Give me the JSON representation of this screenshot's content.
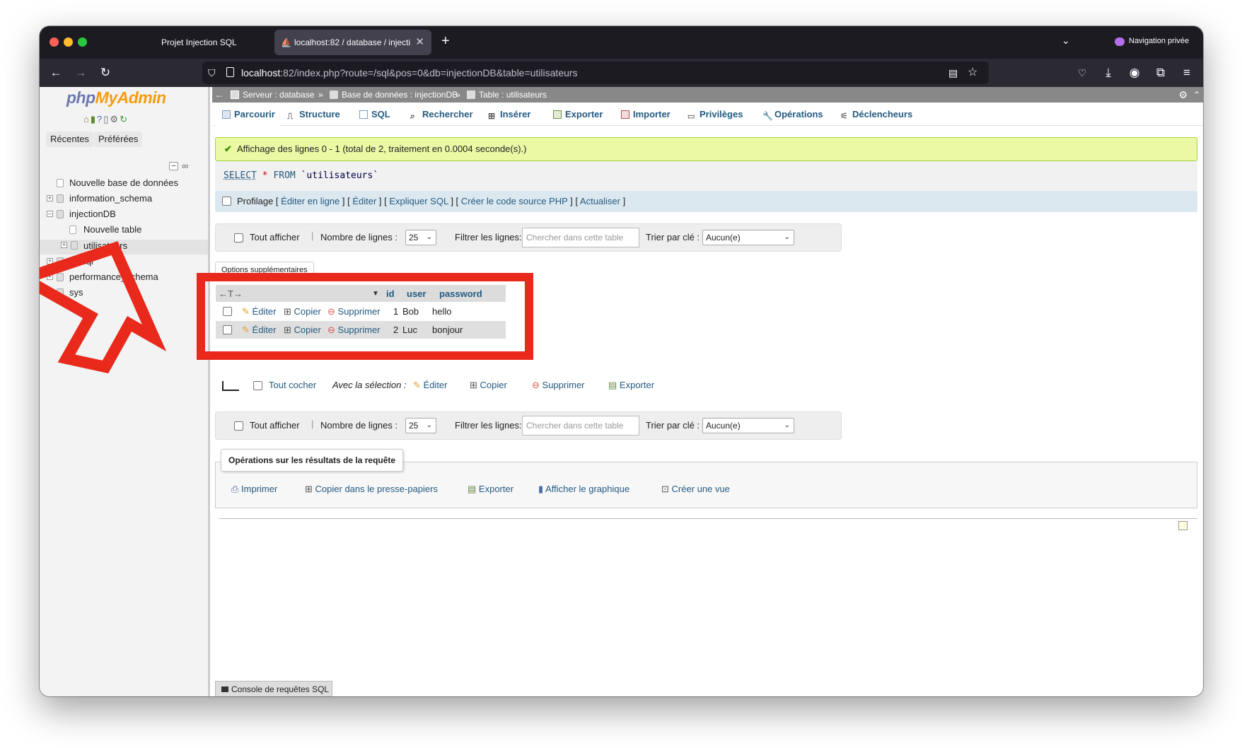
{
  "browser": {
    "tabs": [
      {
        "title": "Projet Injection SQL"
      },
      {
        "title": "localhost:82 / database / injecti"
      }
    ],
    "private_label": "Navigation privée",
    "url_host": "localhost",
    "url_rest": ":82/index.php?route=/sql&pos=0&db=injectionDB&table=utilisateurs"
  },
  "sidebar": {
    "logo_php": "php",
    "logo_my": "MyAdmin",
    "recent_label": "Récentes",
    "favorites_label": "Préférées",
    "tree": [
      {
        "label": "Nouvelle base de données",
        "indent": 0
      },
      {
        "label": "information_schema",
        "indent": 0
      },
      {
        "label": "injectionDB",
        "indent": 0
      },
      {
        "label": "Nouvelle table",
        "indent": 1
      },
      {
        "label": "utilisateurs",
        "indent": 1
      },
      {
        "label": "mysql",
        "indent": 0
      },
      {
        "label": "performance_schema",
        "indent": 0
      },
      {
        "label": "sys",
        "indent": 0
      }
    ]
  },
  "breadcrumb": {
    "server": "Serveur : database",
    "database": "Base de données : injectionDB",
    "table": "Table : utilisateurs"
  },
  "tabs": [
    "Parcourir",
    "Structure",
    "SQL",
    "Rechercher",
    "Insérer",
    "Exporter",
    "Importer",
    "Privilèges",
    "Opérations",
    "Déclencheurs"
  ],
  "result": {
    "success_message": "Affichage des lignes 0 - 1 (total de 2, traitement en 0.0004 seconde(s).)",
    "sql_select": "SELECT",
    "sql_star": "*",
    "sql_from": "FROM",
    "sql_table": "`utilisateurs`",
    "profiling_label": "Profilage",
    "links": [
      "Éditer en ligne",
      "Éditer",
      "Expliquer SQL",
      "Créer le code source PHP",
      "Actualiser"
    ]
  },
  "nav": {
    "show_all": "Tout afficher",
    "rows_label": "Nombre de lignes :",
    "rows_value": "25",
    "filter_label": "Filtrer les lignes:",
    "filter_placeholder": "Chercher dans cette table",
    "sort_label": "Trier par clé :",
    "sort_value": "Aucun(e)"
  },
  "extra_options": "Options supplémentaires",
  "table": {
    "arrows": "←T→",
    "columns": [
      "id",
      "user",
      "password"
    ],
    "actions": {
      "edit": "Éditer",
      "copy": "Copier",
      "delete": "Supprimer"
    },
    "rows": [
      {
        "id": "1",
        "user": "Bob",
        "password": "hello"
      },
      {
        "id": "2",
        "user": "Luc",
        "password": "bonjour"
      }
    ]
  },
  "bulk": {
    "check_all": "Tout cocher",
    "with_selection": "Avec la sélection :",
    "edit": "Éditer",
    "copy": "Copier",
    "delete": "Supprimer",
    "export": "Exporter"
  },
  "query_ops": {
    "title": "Opérations sur les résultats de la requête",
    "items": [
      "Imprimer",
      "Copier dans le presse-papiers",
      "Exporter",
      "Afficher le graphique",
      "Créer une vue"
    ]
  },
  "console": "Console de requêtes SQL",
  "colors": {
    "highlight": "#e8291c",
    "success_bg": "#ebf8a4",
    "link": "#235a81"
  }
}
